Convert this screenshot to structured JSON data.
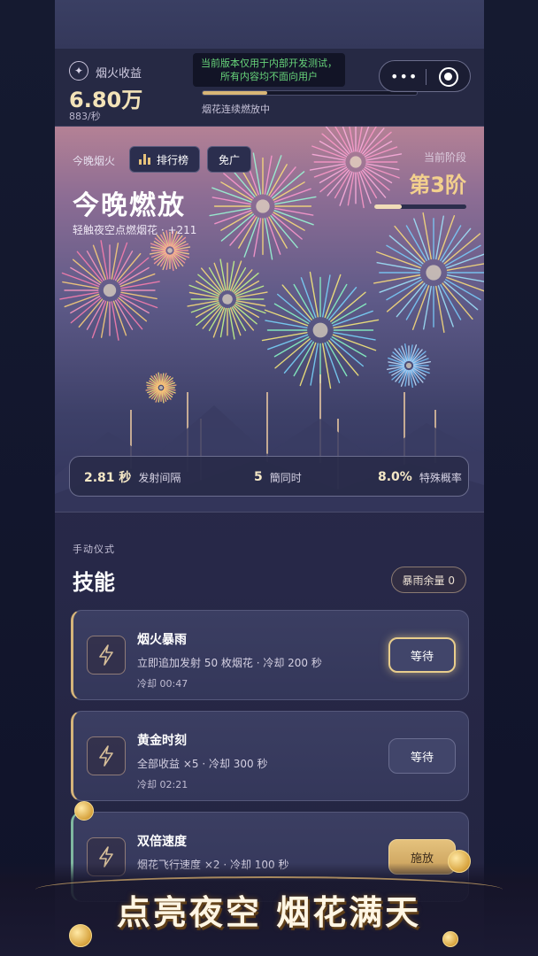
{
  "header": {
    "earnings_icon": "sparkle-icon",
    "earnings_label": "烟火收益",
    "earnings_value": "6.80万",
    "earnings_rate": "883/秒",
    "notice_line1": "当前版本仅用于内部开发测试，",
    "notice_line2": "所有内容均不面向用户",
    "progress_label": "烟花连续燃放中",
    "progress_fraction": 0.3,
    "capsule_hidden_text": "第3阶",
    "capsule_more": "•••"
  },
  "stage": {
    "label": "今晚烟火",
    "rank_button": "排行榜",
    "ad_button": "免广",
    "title": "今晚燃放",
    "subtitle": "轻触夜空点燃烟花 · +211",
    "tier_label": "当前阶段",
    "tier_value": "第3阶",
    "tier_fraction": 0.3,
    "stats": [
      {
        "value": "2.81 秒",
        "label": "发射间隔"
      },
      {
        "value": "5",
        "label": "簡同时"
      },
      {
        "value": "8.0%",
        "label": "特殊概率"
      }
    ]
  },
  "skills": {
    "section_tag": "手动仪式",
    "section_title": "技能",
    "rain_badge": "暴雨余量 0",
    "cards": [
      {
        "title": "烟火暴雨",
        "desc": "立即追加发射 50 枚烟花 · 冷却 200 秒",
        "cooldown": "冷却 00:47",
        "button": "等待",
        "icon": "lightning-icon"
      },
      {
        "title": "黄金时刻",
        "desc": "全部收益 ×5 · 冷却 300 秒",
        "cooldown": "冷却 02:21",
        "button": "等待",
        "icon": "lightning-icon"
      },
      {
        "title": "双倍速度",
        "desc": "烟花飞行速度 ×2 · 冷却 100 秒",
        "cooldown": "",
        "button": "施放",
        "icon": "lightning-icon"
      }
    ]
  },
  "banner": {
    "text": "点亮夜空 烟花满天"
  },
  "colors": {
    "gold": "#f3d08d",
    "accent": "#d5b47a",
    "notice_green": "#67d47a"
  }
}
